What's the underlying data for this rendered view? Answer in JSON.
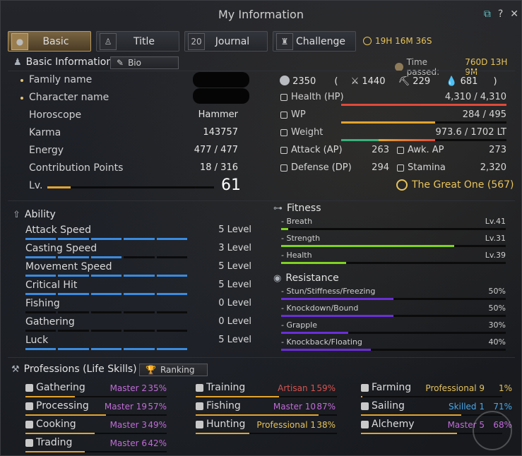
{
  "window": {
    "title": "My Information"
  },
  "tabs": [
    {
      "label": "Basic",
      "icon": "person-icon",
      "active": true
    },
    {
      "label": "Title",
      "icon": "medal-icon",
      "active": false
    },
    {
      "label": "Journal",
      "icon": "calendar-icon",
      "active": false,
      "icon_text": "20"
    },
    {
      "label": "Challenge",
      "icon": "trophy-icon",
      "active": false
    }
  ],
  "timer": "19H 16M 36S",
  "basic_info": {
    "header": "Basic Information",
    "bio_button": "Bio",
    "time_passed_label": "Time passed:",
    "time_passed_value": "760D 13H 9M",
    "family_name_label": "Family name",
    "character_name_label": "Character name",
    "rows": [
      {
        "label": "Horoscope",
        "value": "Hammer"
      },
      {
        "label": "Karma",
        "value": "143757"
      },
      {
        "label": "Energy",
        "value": "477 / 477"
      },
      {
        "label": "Contribution Points",
        "value": "18 / 316"
      }
    ],
    "level_label": "Lv.",
    "level": "61",
    "level_progress": 0.14
  },
  "combat": {
    "gear_score": "2350",
    "ap_total": "1440",
    "awk_total": "229",
    "dp_total": "681",
    "health_label": "Health (HP)",
    "health_value": "4,310 / 4,310",
    "health_fill": 1.0,
    "wp_label": "WP",
    "wp_value": "284 / 495",
    "wp_fill": 0.57,
    "weight_label": "Weight",
    "weight_value": "973.6 / 1702 LT",
    "weight_fill": 0.57,
    "attack_label": "Attack (AP)",
    "attack_value": "263",
    "awk_label": "Awk. AP",
    "awk_value": "273",
    "defense_label": "Defense (DP)",
    "defense_value": "294",
    "stamina_label": "Stamina",
    "stamina_value": "2,320",
    "title": "The Great One (567)"
  },
  "ability": {
    "header": "Ability",
    "rows": [
      {
        "label": "Attack Speed",
        "level": "5 Level",
        "filled": 5
      },
      {
        "label": "Casting Speed",
        "level": "3 Level",
        "filled": 3
      },
      {
        "label": "Movement Speed",
        "level": "5 Level",
        "filled": 5
      },
      {
        "label": "Critical Hit",
        "level": "5 Level",
        "filled": 5
      },
      {
        "label": "Fishing",
        "level": "0 Level",
        "filled": 0
      },
      {
        "label": "Gathering",
        "level": "0 Level",
        "filled": 0
      },
      {
        "label": "Luck",
        "level": "5 Level",
        "filled": 5
      }
    ]
  },
  "fitness": {
    "header": "Fitness",
    "rows": [
      {
        "label": "- Breath",
        "value": "Lv.41",
        "fill": 0.03
      },
      {
        "label": "- Strength",
        "value": "Lv.31",
        "fill": 0.77
      },
      {
        "label": "- Health",
        "value": "Lv.39",
        "fill": 0.29
      }
    ]
  },
  "resistance": {
    "header": "Resistance",
    "rows": [
      {
        "label": "- Stun/Stiffness/Freezing",
        "value": "50%",
        "fill": 0.5
      },
      {
        "label": "- Knockdown/Bound",
        "value": "50%",
        "fill": 0.5
      },
      {
        "label": "- Grapple",
        "value": "30%",
        "fill": 0.3
      },
      {
        "label": "- Knockback/Floating",
        "value": "40%",
        "fill": 0.4
      }
    ]
  },
  "professions": {
    "header": "Professions (Life Skills)",
    "ranking_button": "Ranking",
    "items": [
      {
        "label": "Gathering",
        "grade": "Master 2",
        "pct": "35%",
        "grade_color": "#c06cd8",
        "fill": 0.35
      },
      {
        "label": "Training",
        "grade": "Artisan 1",
        "pct": "59%",
        "grade_color": "#d9534f",
        "fill": 0.59
      },
      {
        "label": "Farming",
        "grade": "Professional 9",
        "pct": "1%",
        "grade_color": "#e7c35b",
        "fill": 0.01
      },
      {
        "label": "Processing",
        "grade": "Master 19",
        "pct": "57%",
        "grade_color": "#c06cd8",
        "fill": 0.57
      },
      {
        "label": "Fishing",
        "grade": "Master 10",
        "pct": "87%",
        "grade_color": "#c06cd8",
        "fill": 0.87
      },
      {
        "label": "Sailing",
        "grade": "Skilled 1",
        "pct": "71%",
        "grade_color": "#4aa6e6",
        "fill": 0.71
      },
      {
        "label": "Cooking",
        "grade": "Master 3",
        "pct": "49%",
        "grade_color": "#c06cd8",
        "fill": 0.49
      },
      {
        "label": "Hunting",
        "grade": "Professional 1",
        "pct": "38%",
        "grade_color": "#e7c35b",
        "fill": 0.38
      },
      {
        "label": "Alchemy",
        "grade": "Master 5",
        "pct": "68%",
        "grade_color": "#c06cd8",
        "fill": 0.68
      },
      {
        "label": "Trading",
        "grade": "Master 6",
        "pct": "42%",
        "grade_color": "#c06cd8",
        "fill": 0.42
      }
    ]
  },
  "colors": {
    "accent": "#e7c35b",
    "hp": "#e04a3a",
    "wp": "#e3a42f",
    "ability": "#3a8be0",
    "fitness": "#7ed321",
    "resistance": "#6a2fd6"
  }
}
